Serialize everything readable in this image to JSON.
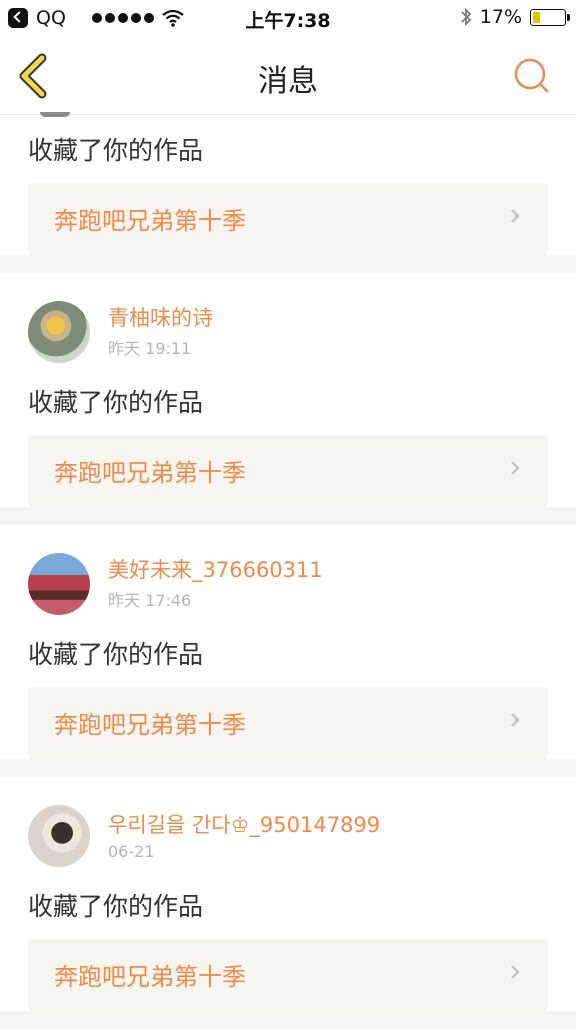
{
  "status_bar": {
    "carrier": "QQ",
    "time": "上午7:38",
    "battery": "17%"
  },
  "nav": {
    "title": "消息",
    "back_icon": "chevron-left-icon",
    "search_icon": "search-icon",
    "accent": "#f08a4b"
  },
  "feed": {
    "items": [
      {
        "username": "",
        "time": "",
        "action": "收藏了你的作品",
        "work_title": "奔跑吧兄弟第十季"
      },
      {
        "username": "青柚味的诗",
        "time": "昨天 19:11",
        "action": "收藏了你的作品",
        "work_title": "奔跑吧兄弟第十季"
      },
      {
        "username": "美好未来_376660311",
        "time": "昨天 17:46",
        "action": "收藏了你的作品",
        "work_title": "奔跑吧兄弟第十季"
      },
      {
        "username": "우리길을 간다♔_950147899",
        "time": "06-21",
        "action": "收藏了你的作品",
        "work_title": "奔跑吧兄弟第十季"
      }
    ]
  }
}
